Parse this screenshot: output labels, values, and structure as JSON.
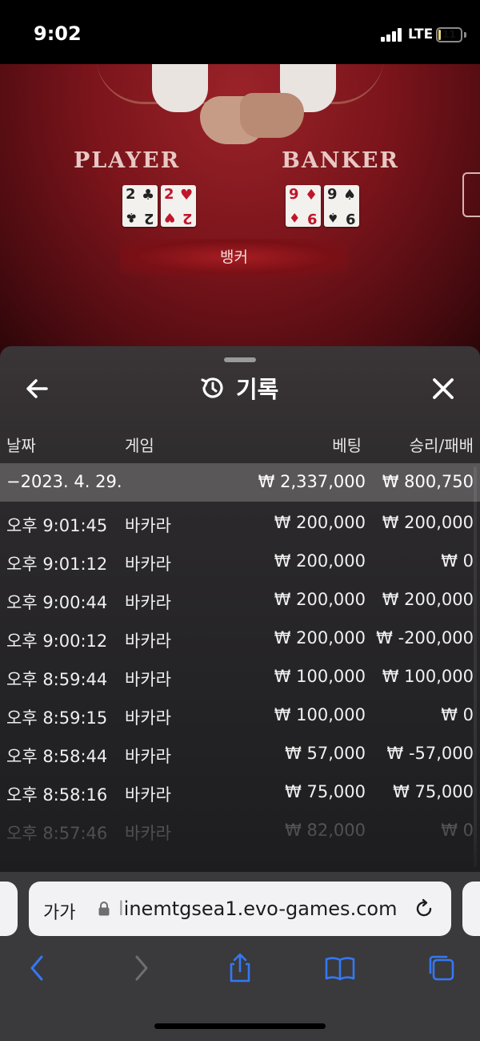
{
  "status_bar": {
    "time": "9:02",
    "network": "LTE",
    "battery": "11",
    "battery_level": 0.11
  },
  "game": {
    "player_label": "PLAYER",
    "banker_label": "BANKER",
    "player_cards": [
      {
        "rank": "2",
        "suit": "♣",
        "color": "black"
      },
      {
        "rank": "2",
        "suit": "♥",
        "color": "red"
      }
    ],
    "banker_cards": [
      {
        "rank": "9",
        "suit": "♦",
        "color": "red"
      },
      {
        "rank": "9",
        "suit": "♠",
        "color": "black"
      }
    ],
    "result": "뱅커"
  },
  "history": {
    "title": "기록",
    "title_icon": "history-clock-icon",
    "back_icon": "back-arrow-icon",
    "close_icon": "close-icon",
    "columns": {
      "date": "날짜",
      "game": "게임",
      "bet": "베팅",
      "win": "승리/패배"
    },
    "summary": {
      "date": "−2023. 4. 29.",
      "bet": "₩ 2,337,000",
      "win": "₩ 800,750"
    },
    "rows": [
      {
        "time": "오후 9:01:45",
        "game": "바카라",
        "bet": "₩ 200,000",
        "win": "₩ 200,000"
      },
      {
        "time": "오후 9:01:12",
        "game": "바카라",
        "bet": "₩ 200,000",
        "win": "₩ 0"
      },
      {
        "time": "오후 9:00:44",
        "game": "바카라",
        "bet": "₩ 200,000",
        "win": "₩ 200,000"
      },
      {
        "time": "오후 9:00:12",
        "game": "바카라",
        "bet": "₩ 200,000",
        "win": "₩ -200,000"
      },
      {
        "time": "오후 8:59:44",
        "game": "바카라",
        "bet": "₩ 100,000",
        "win": "₩ 100,000"
      },
      {
        "time": "오후 8:59:15",
        "game": "바카라",
        "bet": "₩ 100,000",
        "win": "₩ 0"
      },
      {
        "time": "오후 8:58:44",
        "game": "바카라",
        "bet": "₩ 57,000",
        "win": "₩ -57,000"
      },
      {
        "time": "오후 8:58:16",
        "game": "바카라",
        "bet": "₩ 75,000",
        "win": "₩ 75,000"
      },
      {
        "time": "오후 8:57:46",
        "game": "바카라",
        "bet": "₩ 82,000",
        "win": "₩ 0"
      }
    ]
  },
  "browser": {
    "text_size_button": "가가",
    "url_dim": "l",
    "url": "inemtgsea1.evo-games.com",
    "toolbar": [
      "back-icon",
      "forward-icon",
      "share-icon",
      "bookmarks-icon",
      "tabs-icon"
    ],
    "accent": "#3478f6"
  }
}
